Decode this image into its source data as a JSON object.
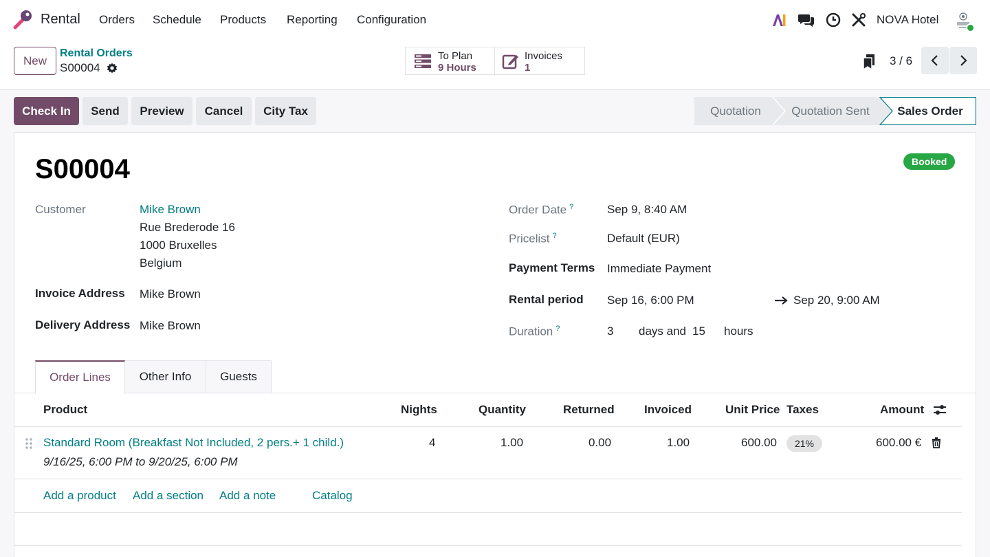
{
  "navbar": {
    "app_name": "Rental",
    "menu": [
      "Orders",
      "Schedule",
      "Products",
      "Reporting",
      "Configuration"
    ],
    "company": "NOVA Hotel"
  },
  "control": {
    "new_label": "New",
    "breadcrumb_parent": "Rental Orders",
    "breadcrumb_current": "S00004",
    "smart_buttons": [
      {
        "title": "To Plan",
        "value": "9 Hours"
      },
      {
        "title": "Invoices",
        "value": "1"
      }
    ],
    "pager": "3 / 6"
  },
  "actions": [
    "Check In",
    "Send",
    "Preview",
    "Cancel",
    "City Tax"
  ],
  "stages": [
    "Quotation",
    "Quotation Sent",
    "Sales Order"
  ],
  "current_stage": "Sales Order",
  "form": {
    "title": "S00004",
    "status_badge": "Booked",
    "customer_label": "Customer",
    "customer_name": "Mike Brown",
    "customer_address": [
      "Rue Brederode 16",
      "1000 Bruxelles",
      "Belgium"
    ],
    "invoice_address_label": "Invoice Address",
    "invoice_address": "Mike Brown",
    "delivery_address_label": "Delivery Address",
    "delivery_address": "Mike Brown",
    "order_date_label": "Order Date",
    "order_date": "Sep 9, 8:40 AM",
    "pricelist_label": "Pricelist",
    "pricelist": "Default (EUR)",
    "payment_terms_label": "Payment Terms",
    "payment_terms": "Immediate Payment",
    "rental_period_label": "Rental period",
    "rental_start": "Sep 16, 6:00 PM",
    "rental_end": "Sep 20, 9:00 AM",
    "duration_label": "Duration",
    "duration_days": "3",
    "days_and": "days and",
    "duration_hours": "15",
    "hours": "hours",
    "help_mark": "?"
  },
  "tabs": [
    "Order Lines",
    "Other Info",
    "Guests"
  ],
  "table": {
    "headers": [
      "Product",
      "Nights",
      "Quantity",
      "Returned",
      "Invoiced",
      "Unit Price",
      "Taxes",
      "Amount"
    ],
    "row": {
      "product": "Standard Room (Breakfast Not Included, 2 pers.+ 1 child.)",
      "period": "9/16/25, 6:00 PM to 9/20/25, 6:00 PM",
      "nights": "4",
      "quantity": "1.00",
      "returned": "0.00",
      "invoiced": "1.00",
      "unit_price": "600.00",
      "tax": "21%",
      "amount": "600.00 €"
    },
    "add_links": [
      "Add a product",
      "Add a section",
      "Add a note",
      "Catalog"
    ]
  },
  "colors": {
    "brand": "#714b67",
    "link": "#017e84",
    "success": "#28a745"
  }
}
